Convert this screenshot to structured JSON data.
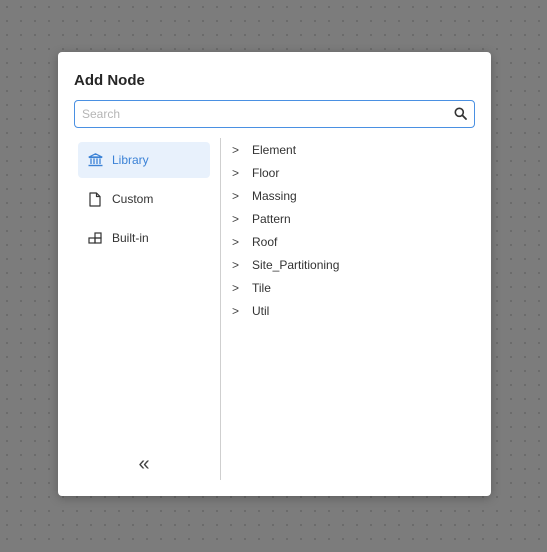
{
  "dialog": {
    "title": "Add Node",
    "search": {
      "placeholder": "Search",
      "value": ""
    },
    "sidebar": {
      "items": [
        {
          "label": "Library",
          "icon": "library-icon",
          "active": true
        },
        {
          "label": "Custom",
          "icon": "file-icon",
          "active": false
        },
        {
          "label": "Built-in",
          "icon": "blocks-icon",
          "active": false
        }
      ],
      "collapse_icon": "double-chevron-left-icon"
    },
    "tree": {
      "items": [
        {
          "label": "Element"
        },
        {
          "label": "Floor"
        },
        {
          "label": "Massing"
        },
        {
          "label": "Pattern"
        },
        {
          "label": "Roof"
        },
        {
          "label": "Site_Partitioning"
        },
        {
          "label": "Tile"
        },
        {
          "label": "Util"
        }
      ]
    }
  },
  "colors": {
    "accent": "#3b82d6",
    "active_bg": "#e8f1fc",
    "backdrop": "#7c7c7c"
  }
}
